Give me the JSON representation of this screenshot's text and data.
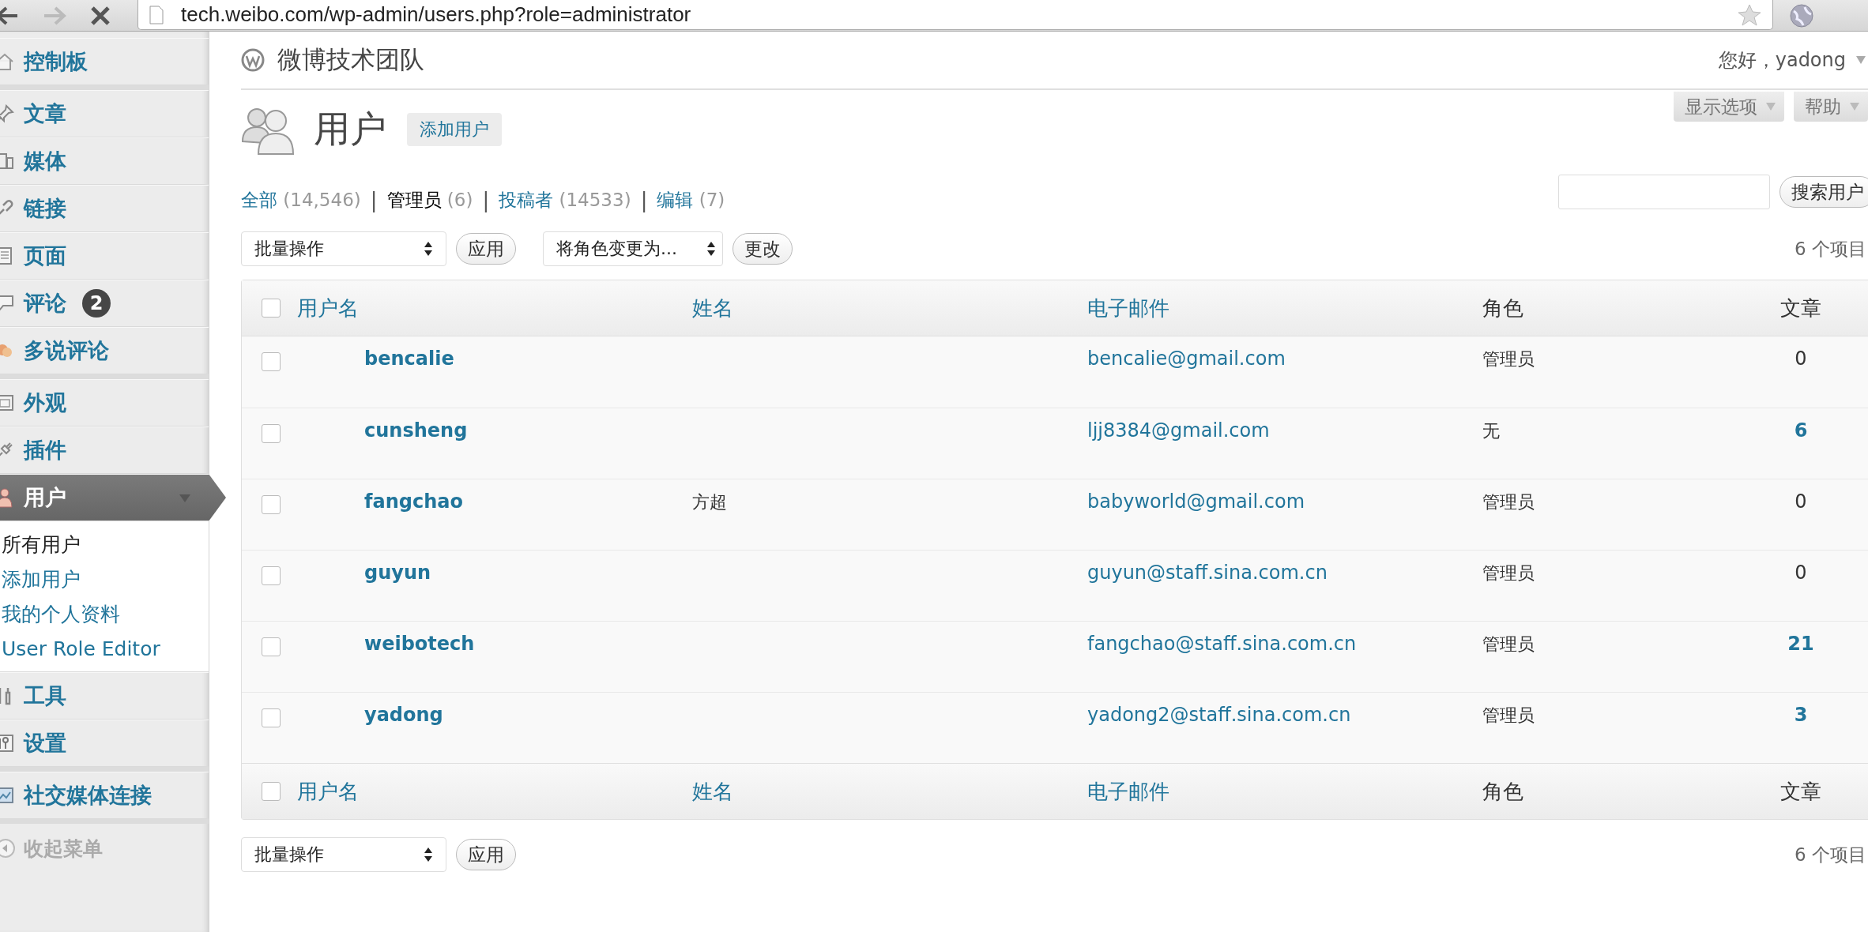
{
  "browser": {
    "url": "tech.weibo.com/wp-admin/users.php?role=administrator"
  },
  "sidebar": {
    "groups": [
      [
        {
          "label": "控制板",
          "selected": false
        }
      ],
      [
        {
          "label": "文章",
          "selected": false
        },
        {
          "label": "媒体",
          "selected": false
        },
        {
          "label": "链接",
          "selected": false
        },
        {
          "label": "页面",
          "selected": false
        },
        {
          "label": "评论",
          "badge": "2",
          "selected": false
        },
        {
          "label": "多说评论",
          "selected": false
        }
      ],
      [
        {
          "label": "外观",
          "selected": false
        },
        {
          "label": "插件",
          "selected": false
        },
        {
          "label": "用户",
          "selected": true,
          "children": [
            {
              "label": "所有用户",
              "selected": true
            },
            {
              "label": "添加用户",
              "selected": false
            },
            {
              "label": "我的个人资料",
              "selected": false
            },
            {
              "label": "User Role Editor",
              "selected": false
            }
          ]
        },
        {
          "label": "工具",
          "selected": false
        },
        {
          "label": "设置",
          "selected": false
        }
      ],
      [
        {
          "label": "社交媒体连接",
          "selected": false
        }
      ]
    ],
    "collapse": "收起菜单"
  },
  "header": {
    "site_title": "微博技术团队",
    "greeting": "您好，yadong",
    "screen_options": "显示选项",
    "help": "帮助"
  },
  "page": {
    "title": "用户",
    "add_button": "添加用户"
  },
  "filters": [
    {
      "label": "全部",
      "count": "(14,546)",
      "selected": false
    },
    {
      "separator": "|",
      "label": "管理员",
      "count": "(6)",
      "selected": true
    },
    {
      "separator": "|",
      "label": "投稿者",
      "count": "(14533)",
      "selected": false
    },
    {
      "separator": "|",
      "label": "编辑",
      "count": "(7)",
      "selected": false
    }
  ],
  "search": {
    "button": "搜索用户"
  },
  "top_actions": {
    "bulk": "批量操作",
    "apply": "应用",
    "role_select": "将角色变更为...",
    "change": "更改",
    "count": "6 个项目"
  },
  "table": {
    "select_all_checked": false,
    "footer_select_all_checked": false,
    "footer_columns": [
      {
        "label": "用户名",
        "sortable": true
      },
      {
        "label": "姓名",
        "sortable": true
      },
      {
        "label": "电子邮件",
        "sortable": true
      },
      {
        "label": "角色",
        "sortable": false
      },
      {
        "label": "文章",
        "sortable": false
      }
    ],
    "columns": [
      {
        "label": "用户名",
        "sortable": true
      },
      {
        "label": "姓名",
        "sortable": true
      },
      {
        "label": "电子邮件",
        "sortable": true
      },
      {
        "label": "角色",
        "sortable": false
      },
      {
        "label": "文章",
        "sortable": false
      }
    ],
    "rows": [
      {
        "checked": false,
        "username": "bencalie",
        "name": "",
        "email": "bencalie@gmail.com",
        "role": "管理员",
        "posts": "0",
        "posts_linked": false
      },
      {
        "checked": false,
        "username": "cunsheng",
        "name": "",
        "email": "ljj8384@gmail.com",
        "role": "无",
        "posts": "6",
        "posts_linked": true
      },
      {
        "checked": false,
        "username": "fangchao",
        "name": "方超",
        "email": "babyworld@gmail.com",
        "role": "管理员",
        "posts": "0",
        "posts_linked": false
      },
      {
        "checked": false,
        "username": "guyun",
        "name": "",
        "email": "guyun@staff.sina.com.cn",
        "role": "管理员",
        "posts": "0",
        "posts_linked": false
      },
      {
        "checked": false,
        "username": "weibotech",
        "name": "",
        "email": "fangchao@staff.sina.com.cn",
        "role": "管理员",
        "posts": "21",
        "posts_linked": true
      },
      {
        "checked": false,
        "username": "yadong",
        "name": "",
        "email": "yadong2@staff.sina.com.cn",
        "role": "管理员",
        "posts": "3",
        "posts_linked": true
      }
    ]
  },
  "bottom_actions": {
    "bulk": "批量操作",
    "apply": "应用",
    "count": "6 个项目"
  }
}
